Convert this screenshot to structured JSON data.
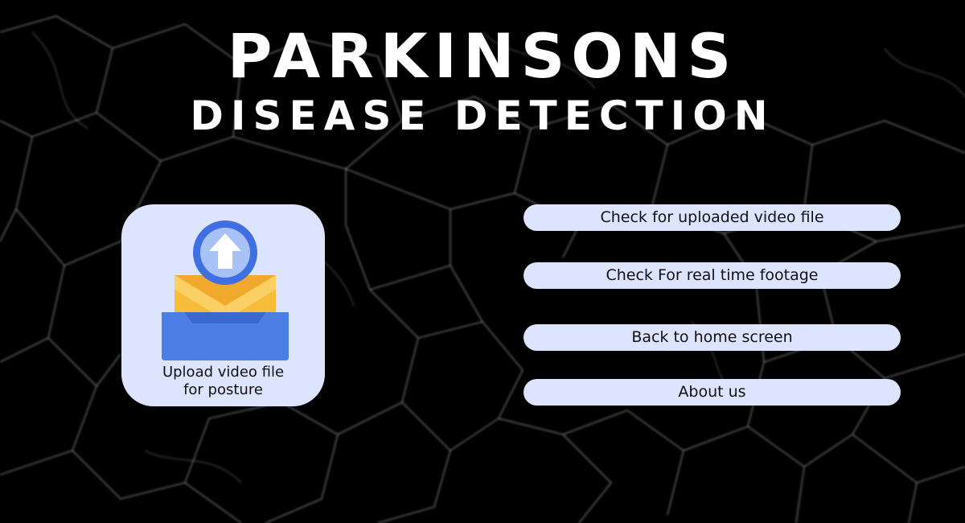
{
  "header": {
    "title_line1": "PARKINSONS",
    "title_line2": "DISEASE DETECTION"
  },
  "upload_card": {
    "label_line1": "Upload video file",
    "label_line2": "for posture",
    "icon": "upload-envelope-icon"
  },
  "actions": {
    "uploaded_label": "Check for uploaded video file",
    "realtime_label": "Check For real time footage",
    "home_label": "Back to home screen",
    "about_label": "About us"
  },
  "colors": {
    "background": "#000000",
    "button_fill": "#dde4ff",
    "title_text": "#ffffff",
    "upload_circle": "#3f6fe0",
    "envelope": "#f6bd3b",
    "tray": "#4b7fe6"
  }
}
